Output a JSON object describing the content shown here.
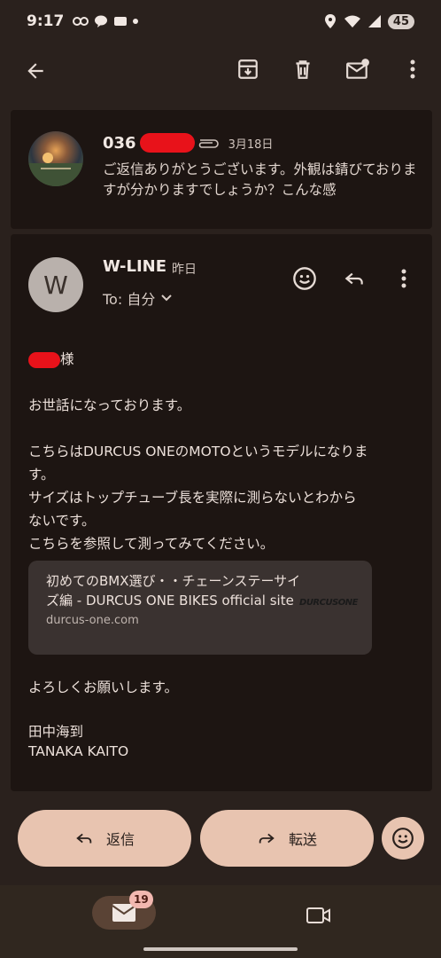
{
  "status_bar": {
    "time": "9:17",
    "battery": "45"
  },
  "toolbar": {
    "icons": [
      "back-arrow-icon",
      "archive-icon",
      "trash-icon",
      "mark-unread-icon",
      "more-vert-icon"
    ]
  },
  "thread": {
    "collapsed_message": {
      "sender_prefix": "036",
      "date": "3月18日",
      "snippet": "ご返信ありがとうございます。外観は錆びておりますが分かりますでしょうか？こんな感"
    },
    "open_message": {
      "avatar_letter": "W",
      "sender": "W-LINE",
      "when": "昨日",
      "to": "To: 自分",
      "salutation_suffix": "様",
      "greeting": "お世話になっております。",
      "para1_line1": "こちらはDURCUS ONEのMOTOというモデルになりま",
      "para1_line2": "す。",
      "para1_line3": "サイズはトップチューブ長を実際に測らないとわから",
      "para1_line4": "ないです。",
      "para1_line5": "こちらを参照して測ってみてください。",
      "link_preview": {
        "title": "初めてのBMX選び・・チェーンステーサイズ編 - DURCUS ONE BIKES official site",
        "url": "durcus-one.com",
        "logo": "DURCUSONE"
      },
      "closing": "よろしくお願いします。",
      "signature_name": "田中海到",
      "signature_roman": "TANAKA KAITO"
    }
  },
  "reply_actions": {
    "reply": "返信",
    "forward": "転送"
  },
  "bottom_nav": {
    "mail_badge": "19"
  }
}
